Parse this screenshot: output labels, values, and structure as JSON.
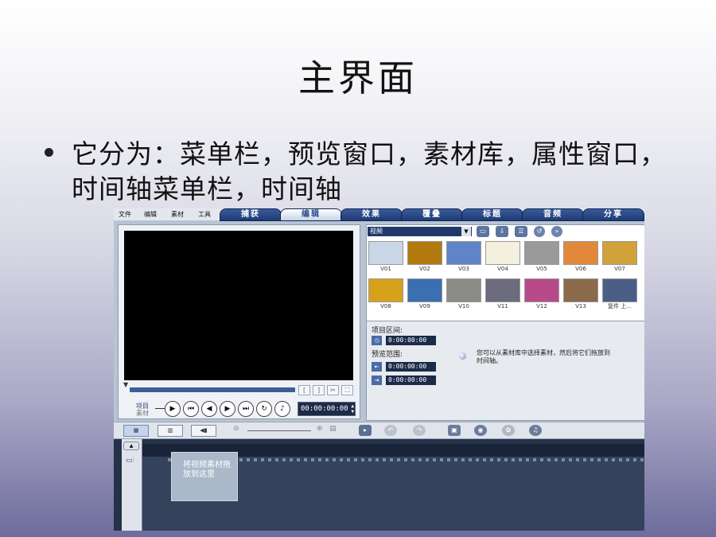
{
  "slide": {
    "title": "主界面",
    "bullet": "它分为：菜单栏，预览窗口，素材库，属性窗口，时间轴菜单栏，时间轴"
  },
  "app": {
    "menu": [
      "文件",
      "编辑",
      "素材",
      "工具"
    ],
    "steps": [
      {
        "label": "捕获",
        "active": false
      },
      {
        "label": "编辑",
        "active": true
      },
      {
        "label": "效果",
        "active": false
      },
      {
        "label": "覆叠",
        "active": false
      },
      {
        "label": "标题",
        "active": false
      },
      {
        "label": "音频",
        "active": false
      },
      {
        "label": "分享",
        "active": false
      }
    ],
    "preview": {
      "mode_project": "项目",
      "mode_clip": "素材",
      "timecode": "00:00:00:00"
    },
    "library": {
      "category": "视频",
      "thumbnails": [
        {
          "label": "V01",
          "color": "#c9d6e6"
        },
        {
          "label": "V02",
          "color": "#b37a10"
        },
        {
          "label": "V03",
          "color": "#5f84c8"
        },
        {
          "label": "V04",
          "color": "#f4f0de"
        },
        {
          "label": "V05",
          "color": "#9a9a9a"
        },
        {
          "label": "V06",
          "color": "#e2883a"
        },
        {
          "label": "V07",
          "color": "#d2a23a"
        },
        {
          "label": "V08",
          "color": "#d6a21c"
        },
        {
          "label": "V09",
          "color": "#3a6fb2"
        },
        {
          "label": "V10",
          "color": "#8c8c86"
        },
        {
          "label": "V11",
          "color": "#6c6c7e"
        },
        {
          "label": "V12",
          "color": "#b84a8a"
        },
        {
          "label": "V13",
          "color": "#8a6a4a"
        },
        {
          "label": "复件 上...",
          "color": "#4a5e86"
        }
      ]
    },
    "properties": {
      "project_duration_label": "项目区间:",
      "project_duration": "0:00:00:00",
      "preview_range_label": "预览范围:",
      "range_start": "0:00:00:00",
      "range_end": "0:00:00:00",
      "hint": "您可以从素材库中选择素材，然后将它们拖放到时间轴。"
    },
    "timeline": {
      "drop_hint": "将视频素材拖放到这里"
    }
  }
}
